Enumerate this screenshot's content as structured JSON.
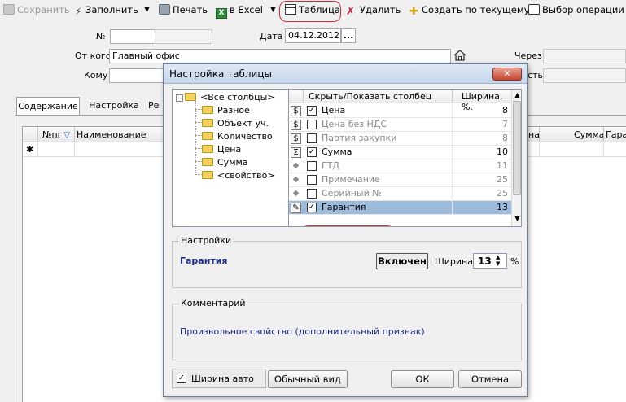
{
  "toolbar": {
    "save": "Сохранить",
    "fill": "Заполнить",
    "print": "Печать",
    "excel": "в Excel",
    "table": "Таблица",
    "delete": "Удалить",
    "create_from_current": "Создать по текущему",
    "select_operation": "Выбор операции"
  },
  "form": {
    "number_label": "№",
    "date_label": "Дата",
    "date_value": "04.12.2012",
    "date_button": "...",
    "from_label": "От кого",
    "from_value": "Главный офис",
    "to_label": "Кому",
    "via_label": "Через",
    "partial_label": "сть"
  },
  "tabs": [
    {
      "label": "Содержание"
    },
    {
      "label": "Настройка"
    },
    {
      "label": "Ре"
    }
  ],
  "main_grid": {
    "col_num": "№пг",
    "col_name": "Наименование",
    "col_partial": "на",
    "col_sum": "Сумма",
    "col_guarantee": "Гаранти",
    "new_row_marker": "✱"
  },
  "dialog": {
    "title": "Настройка таблицы",
    "close_symbol": "✕",
    "tree": {
      "root": "<Все столбцы>",
      "items": [
        "Разное",
        "Объект уч.",
        "Количество",
        "Цена",
        "Сумма",
        "<свойство>"
      ]
    },
    "grid": {
      "col_show": "Скрыть/Показать столбец",
      "col_width": "Ширина, %.",
      "rows": [
        {
          "icon": "coin",
          "checked": true,
          "name": "Цена",
          "width": "8"
        },
        {
          "icon": "coin",
          "checked": false,
          "name": "Цена без НДС",
          "width": "7"
        },
        {
          "icon": "coin",
          "checked": false,
          "name": "Партия закупки",
          "width": "8"
        },
        {
          "icon": "sigma",
          "checked": true,
          "name": "Сумма",
          "width": "10"
        },
        {
          "icon": "diamond",
          "checked": false,
          "name": "ГТД",
          "width": "11"
        },
        {
          "icon": "diamond",
          "checked": false,
          "name": "Примечание",
          "width": "25"
        },
        {
          "icon": "diamond",
          "checked": false,
          "name": "Серийный №",
          "width": "25"
        },
        {
          "icon": "edit",
          "checked": true,
          "name": "Гарантия",
          "width": "13"
        }
      ]
    },
    "settings": {
      "legend": "Настройки",
      "column_name": "Гарантия",
      "toggle_button": "Включен",
      "width_label": "Ширина=",
      "width_value": "13",
      "percent": "%"
    },
    "comment": {
      "legend": "Комментарий",
      "text": "Произвольное свойство (дополнительный признак)"
    },
    "auto_width_label": "Ширина авто",
    "normal_view_button": "Обычный вид",
    "ok_button": "ОК",
    "cancel_button": "Отмена"
  }
}
